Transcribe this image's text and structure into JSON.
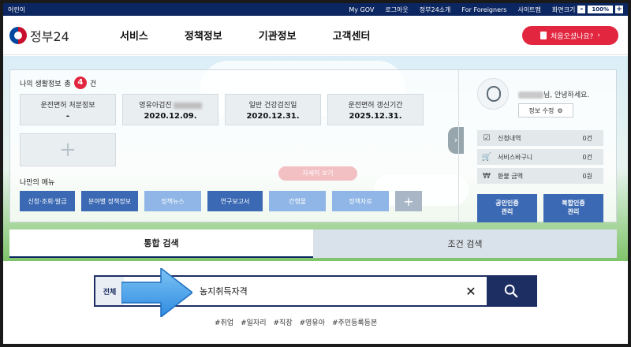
{
  "utility": {
    "kids": "어린이",
    "links": [
      "My GOV",
      "로그아웃",
      "정부24소개",
      "For Foreigners",
      "사이트맵",
      "화면크기"
    ],
    "zoom": "100%",
    "zoom_minus": "-",
    "zoom_plus": "+"
  },
  "header": {
    "logo_text": "정부24",
    "nav": [
      "서비스",
      "정책정보",
      "기관정보",
      "고객센터"
    ],
    "first_visit": "처음오셨나요?",
    "first_visit_arrow": "›"
  },
  "life_info": {
    "title_prefix": "나의 생활정보",
    "title_mid": "총",
    "count": "4",
    "title_suffix": "건",
    "cards": [
      {
        "title": "운전면허 처분정보",
        "value": "-"
      },
      {
        "title": "영유아검진",
        "value": "2020.12.09."
      },
      {
        "title": "일반 건강검진일",
        "value": "2020.12.31."
      },
      {
        "title": "운전면허 갱신기간",
        "value": "2025.12.31."
      }
    ],
    "add": "+",
    "next": "›"
  },
  "promo": "자세히 보기",
  "my_menu": {
    "title": "나만의 메뉴",
    "items": [
      "신청·조회·발급",
      "분야별 정책정보",
      "정책뉴스",
      "연구보고서",
      "간행물",
      "정책자료"
    ],
    "add": "+"
  },
  "user": {
    "greeting": "님, 안녕하세요.",
    "edit": "정보 수정",
    "stats": [
      {
        "icon": "document-check-icon",
        "label": "신청내역",
        "value": "0건"
      },
      {
        "icon": "cart-icon",
        "label": "서비스바구니",
        "value": "0건"
      },
      {
        "icon": "won-icon",
        "label": "환불 금액",
        "value": "0원"
      }
    ],
    "cert1": "공인인증\n관리",
    "cert2": "복합인증\n관리"
  },
  "search": {
    "tab_active": "통합 검색",
    "tab_other": "조건 검색",
    "scope": "전체",
    "query": "농지취득자격",
    "clear": "✕",
    "tags": [
      "#취업",
      "#일자리",
      "#직장",
      "#영유아",
      "#주민등록등본"
    ]
  },
  "colors": {
    "navy": "#0b2660",
    "red": "#e2263f",
    "menu_blue": "#3b69b3",
    "menu_light": "#8fb6e6",
    "arrow_blue": "#2f8be0"
  }
}
